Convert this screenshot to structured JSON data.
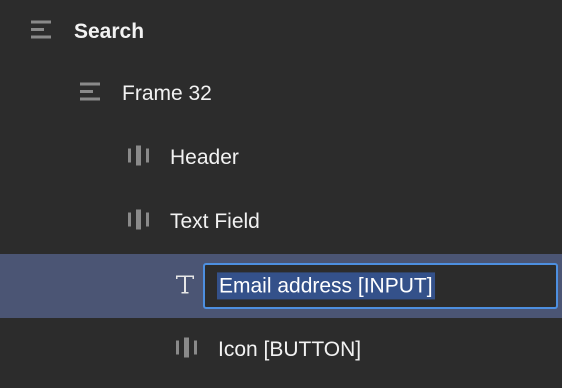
{
  "layers": {
    "search": {
      "label": "Search",
      "icon": "frame-icon"
    },
    "frame": {
      "label": "Frame 32",
      "icon": "frame-icon"
    },
    "header": {
      "label": "Header",
      "icon": "auto-layout-icon"
    },
    "text_field": {
      "label": "Text Field",
      "icon": "auto-layout-icon"
    },
    "email": {
      "value": "Email address [INPUT]",
      "icon": "text-icon"
    },
    "icon_button": {
      "label": "Icon [BUTTON]",
      "icon": "auto-layout-icon"
    }
  },
  "colors": {
    "background": "#2c2c2c",
    "selected_row": "#4b5574",
    "focus_border": "#4d8fe0",
    "text_selection": "#34518a",
    "icon": "#8a8a8a"
  }
}
